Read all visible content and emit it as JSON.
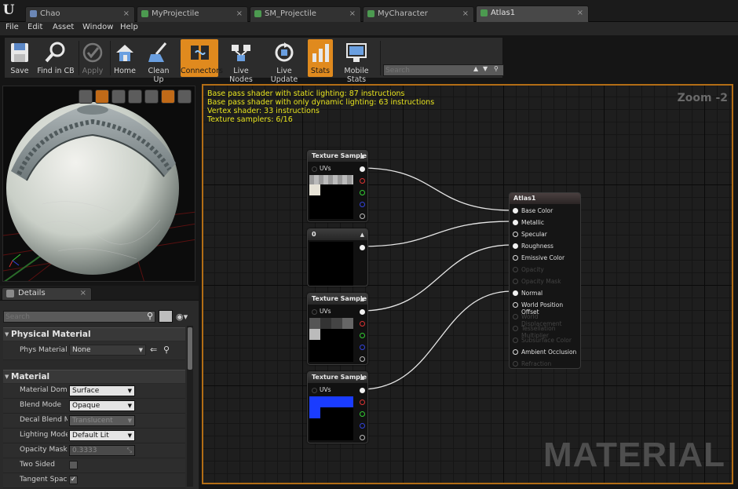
{
  "tabs": [
    {
      "label": "Chao",
      "color": "#6b87b6"
    },
    {
      "label": "MyProjectile",
      "color": "#4c9a50"
    },
    {
      "label": "SM_Projectile",
      "color": "#4c9a50"
    },
    {
      "label": "MyCharacter",
      "color": "#4c9a50"
    },
    {
      "label": "Atlas1",
      "color": "#4c9a50"
    }
  ],
  "menu": [
    "File",
    "Edit",
    "Asset",
    "Window",
    "Help"
  ],
  "toolbar": {
    "save": "Save",
    "find": "Find in CB",
    "apply": "Apply",
    "home": "Home",
    "cleanup": "Clean Up",
    "connectors": "Connectors",
    "livenodes": "Live Nodes",
    "liveupdate": "Live Update",
    "stats": "Stats",
    "mobilestats": "Mobile Stats",
    "search_placeholder": "Search"
  },
  "details": {
    "tab": "Details",
    "search_placeholder": "Search",
    "physical_material": "Physical Material",
    "phys_material_label": "Phys Material",
    "phys_material_value": "None",
    "material": "Material",
    "rows": [
      {
        "label": "Material Domain",
        "value": "Surface"
      },
      {
        "label": "Blend Mode",
        "value": "Opaque"
      },
      {
        "label": "Decal Blend Mode",
        "value": "Translucent"
      },
      {
        "label": "Lighting Model",
        "value": "Default Lit"
      },
      {
        "label": "Opacity Mask Clip",
        "value": "0.3333"
      },
      {
        "label": "Two Sided",
        "value": ""
      },
      {
        "label": "Tangent Space",
        "value": "✓"
      }
    ]
  },
  "graph": {
    "stats": [
      "Base pass shader with static lighting: 87 instructions",
      "Base pass shader with only dynamic lighting: 63 instructions",
      "Vertex shader: 33 instructions",
      "Texture samplers: 6/16"
    ],
    "zoom": "Zoom -2",
    "watermark": "MATERIAL",
    "tex1_title": "Texture Sample",
    "tex1_uv": "UVs",
    "const_title": "0",
    "tex2_title": "Texture Sample",
    "tex2_uv": "UVs",
    "tex3_title": "Texture Sample",
    "tex3_uv": "UVs",
    "result_title": "Atlas1",
    "result_pins": [
      "Base Color",
      "Metallic",
      "Specular",
      "Roughness",
      "Emissive Color",
      "Opacity",
      "Opacity Mask",
      "Normal",
      "World Position Offset",
      "World Displacement",
      "Tessellation Multiplier",
      "Subsurface Color",
      "Ambient Occlusion",
      "Refraction"
    ]
  },
  "colors": {
    "accent": "#e08a1e",
    "stats_text": "#e8e41e",
    "graph_border": "#b36d15"
  }
}
